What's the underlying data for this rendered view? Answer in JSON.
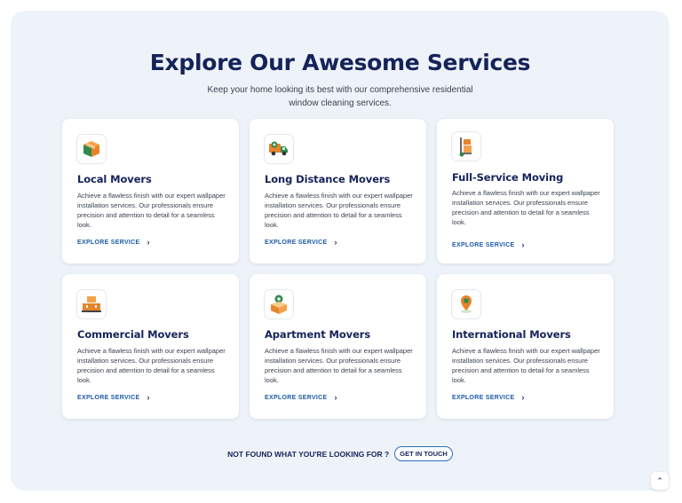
{
  "section": {
    "title": "Explore Our Awesome Services",
    "subtitle": "Keep your home looking its best with our comprehensive residential window cleaning services."
  },
  "services": [
    {
      "name": "Local Movers",
      "icon": "box-icon",
      "description": "Achieve a flawless finish with our expert wallpaper installation services. Our professionals ensure precision and attention to detail for a seamless look.",
      "link": "EXPLORE SERVICE"
    },
    {
      "name": "Long Distance Movers",
      "icon": "truck-icon",
      "description": "Achieve a flawless finish with our expert wallpaper installation services. Our professionals ensure precision and attention to detail for a seamless look.",
      "link": "EXPLORE SERVICE"
    },
    {
      "name": "Full-Service Moving",
      "icon": "hand-truck-icon",
      "description": "Achieve a flawless finish with our expert wallpaper installation services. Our professionals ensure precision and attention to detail for a seamless look.",
      "link": "EXPLORE SERVICE"
    },
    {
      "name": "Commercial Movers",
      "icon": "boxes-icon",
      "description": "Achieve a flawless finish with our expert wallpaper installation services. Our professionals ensure precision and attention to detail for a seamless look.",
      "link": "EXPLORE SERVICE"
    },
    {
      "name": "Apartment Movers",
      "icon": "open-box-icon",
      "description": "Achieve a flawless finish with our expert wallpaper installation services. Our professionals ensure precision and attention to detail for a seamless look.",
      "link": "EXPLORE SERVICE"
    },
    {
      "name": "International Movers",
      "icon": "location-pin-icon",
      "description": "Achieve a flawless finish with our expert wallpaper installation services. Our professionals ensure precision and attention to detail for a seamless look.",
      "link": "EXPLORE SERVICE"
    }
  ],
  "footer": {
    "question": "NOT FOUND WHAT YOU'RE LOOKING FOR ?",
    "button": "GET IN TOUCH"
  },
  "scroll_top_icon": "chevron-up-icon",
  "colors": {
    "background": "#eef3f9",
    "heading": "#16235a",
    "link": "#1d5aa8",
    "icon_orange": "#e8832a",
    "icon_green": "#2f8a4e"
  }
}
